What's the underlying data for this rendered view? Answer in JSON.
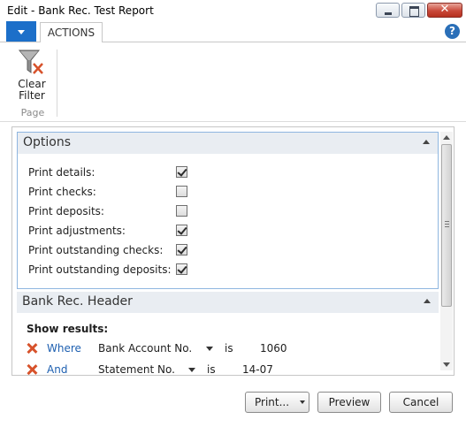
{
  "window": {
    "title": "Edit - Bank Rec. Test Report",
    "close_glyph": "✕"
  },
  "ribbon": {
    "tab_label": "ACTIONS",
    "help_glyph": "?",
    "clear_filter_line1": "Clear",
    "clear_filter_line2": "Filter",
    "group_label": "Page"
  },
  "options": {
    "title": "Options",
    "items": [
      {
        "label": "Print details:",
        "checked": true
      },
      {
        "label": "Print checks:",
        "checked": false
      },
      {
        "label": "Print deposits:",
        "checked": false
      },
      {
        "label": "Print adjustments:",
        "checked": true
      },
      {
        "label": "Print outstanding checks:",
        "checked": true
      },
      {
        "label": "Print outstanding deposits:",
        "checked": true
      }
    ]
  },
  "header_tab": {
    "title": "Bank Rec. Header",
    "show_results": "Show results:",
    "filters": [
      {
        "conjunction": "Where",
        "field": "Bank Account No.",
        "operator": "is",
        "value": "1060"
      },
      {
        "conjunction": "And",
        "field": "Statement No.",
        "operator": "is",
        "value": "14-07"
      }
    ]
  },
  "buttons": {
    "print": "Print...",
    "preview": "Preview",
    "cancel": "Cancel"
  }
}
